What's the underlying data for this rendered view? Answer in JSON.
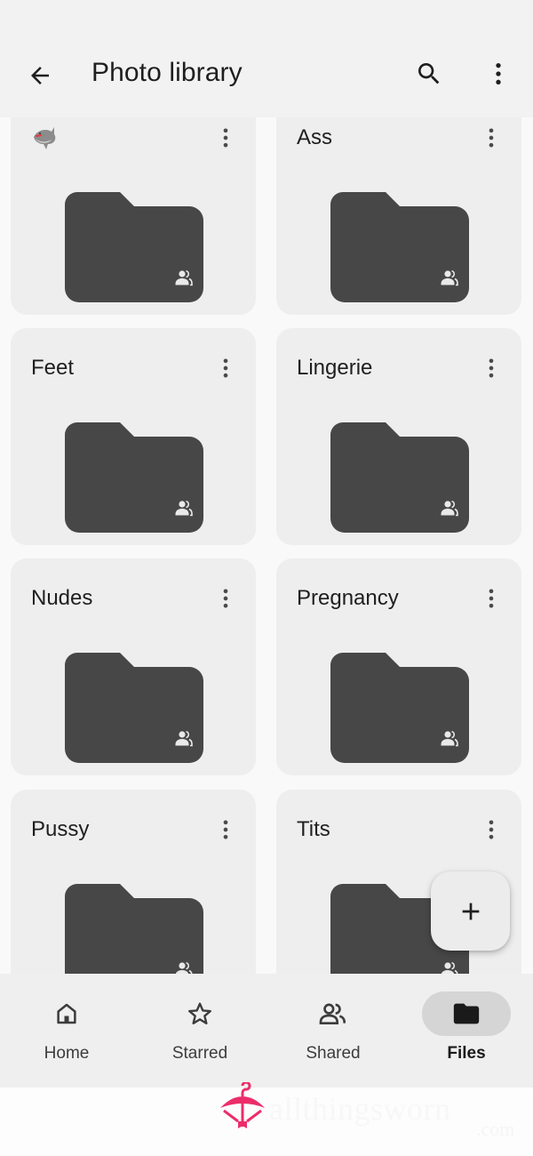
{
  "app_bar": {
    "title": "Photo library",
    "back_icon": "arrow-back-icon",
    "search_icon": "search-icon",
    "more_icon": "more-vert-icon"
  },
  "folders": [
    {
      "name": "",
      "emoji": "shark",
      "shared": true
    },
    {
      "name": "Ass",
      "shared": true
    },
    {
      "name": "Feet",
      "shared": true
    },
    {
      "name": "Lingerie",
      "shared": true
    },
    {
      "name": "Nudes",
      "shared": true
    },
    {
      "name": "Pregnancy",
      "shared": true
    },
    {
      "name": "Pussy",
      "shared": true
    },
    {
      "name": "Tits",
      "shared": true
    }
  ],
  "fab": {
    "icon": "plus-icon",
    "label": "+"
  },
  "bottom_nav": {
    "items": [
      {
        "label": "Home",
        "icon": "home-icon",
        "active": false
      },
      {
        "label": "Starred",
        "icon": "star-icon",
        "active": false
      },
      {
        "label": "Shared",
        "icon": "people-icon",
        "active": false
      },
      {
        "label": "Files",
        "icon": "folder-icon",
        "active": true
      }
    ]
  },
  "watermark": {
    "text": "allthingsworn",
    "suffix": ".com",
    "accent": "#ec2d6a"
  },
  "colors": {
    "folder": "#474747",
    "card": "#eeeeee",
    "appbar": "#f2f2f2",
    "nav_active_pill": "#d5d5d5"
  }
}
